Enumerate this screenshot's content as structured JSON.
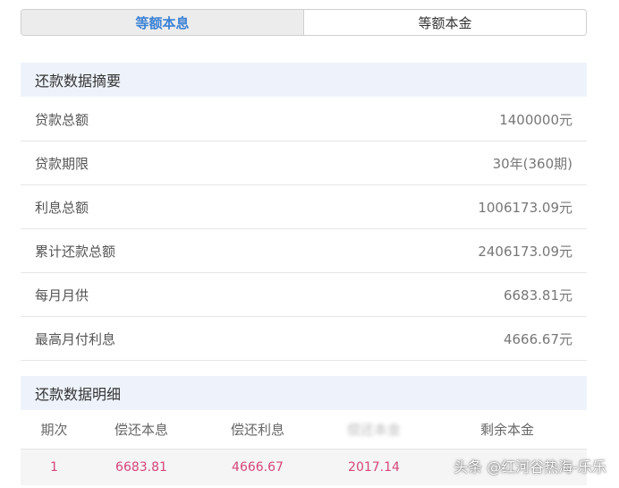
{
  "tabs": [
    {
      "label": "等额本息",
      "active": true
    },
    {
      "label": "等额本金",
      "active": false
    }
  ],
  "summary": {
    "title": "还款数据摘要",
    "rows": [
      {
        "label": "贷款总额",
        "value": "1400000元"
      },
      {
        "label": "贷款期限",
        "value": "30年(360期)"
      },
      {
        "label": "利息总额",
        "value": "1006173.09元"
      },
      {
        "label": "累计还款总额",
        "value": "2406173.09元"
      },
      {
        "label": "每月月供",
        "value": "6683.81元"
      },
      {
        "label": "最高月付利息",
        "value": "4666.67元"
      }
    ]
  },
  "detail": {
    "title": "还款数据明细",
    "columns": [
      "期次",
      "偿还本息",
      "偿还利息",
      "偿还本金",
      "剩余本金"
    ],
    "rows": [
      [
        "1",
        "6683.81",
        "4666.67",
        "2017.14",
        ""
      ]
    ]
  },
  "watermark": "头条 @红河谷热海-乐乐",
  "colors": {
    "accent": "#3b82d6",
    "detail_value": "#d6457a",
    "header_bg": "#eef3fb"
  }
}
